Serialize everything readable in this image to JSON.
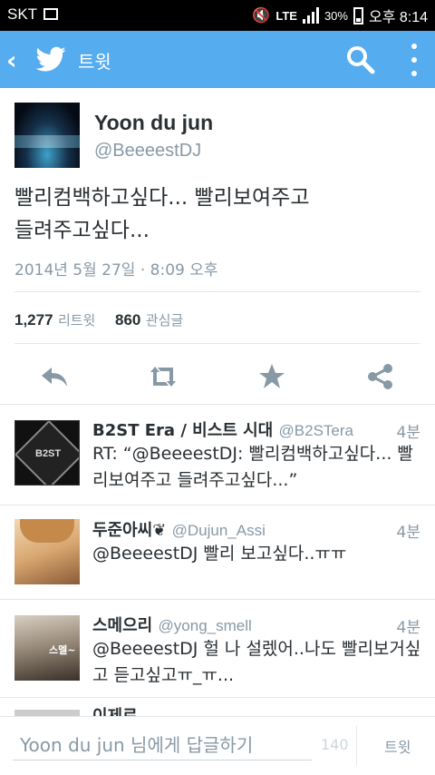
{
  "status_bar": {
    "carrier": "SKT",
    "network": "LTE",
    "battery": "30%",
    "clock": "오후 8:14"
  },
  "app_bar": {
    "back_symbol": "‹",
    "title": "트윗",
    "accent": "#55acee"
  },
  "tweet": {
    "author_name": "Yoon du jun",
    "author_handle": "@BeeeestDJ",
    "text_line1": "빨리컴백하고싶다... 빨리보여주고",
    "text_line2": "들려주고싶다...",
    "timestamp": "2014년 5월 27일 · 8:09 오후",
    "retweet_count": "1,277",
    "retweet_label": "리트윗",
    "favorite_count": "860",
    "favorite_label": "관심글"
  },
  "replies": [
    {
      "name": "B2ST Era / 비스트 시대",
      "handle": "@B2STera",
      "time": "4분",
      "text": "RT: “@BeeeestDJ: 빨리컴백하고싶다... 빨리보여주고 들려주고싶다...”"
    },
    {
      "name": "두준아씨❦",
      "handle": "@Dujun_Assi",
      "time": "4분",
      "text": "@BeeeestDJ 빨리 보고싶다..ㅠㅠ"
    },
    {
      "name": "스메으리",
      "handle": "@yong_smell",
      "time": "4분",
      "text": "@BeeeestDJ 헐 나 설렜어..나도 빨리보거싶고 듣고싶고ㅠ_ㅠ..."
    },
    {
      "name": "이제르",
      "handle": "",
      "time": "",
      "text": ""
    }
  ],
  "composer": {
    "placeholder": "Yoon du jun 님에게 답글하기",
    "char_count": "140",
    "send_label": "트윗"
  }
}
